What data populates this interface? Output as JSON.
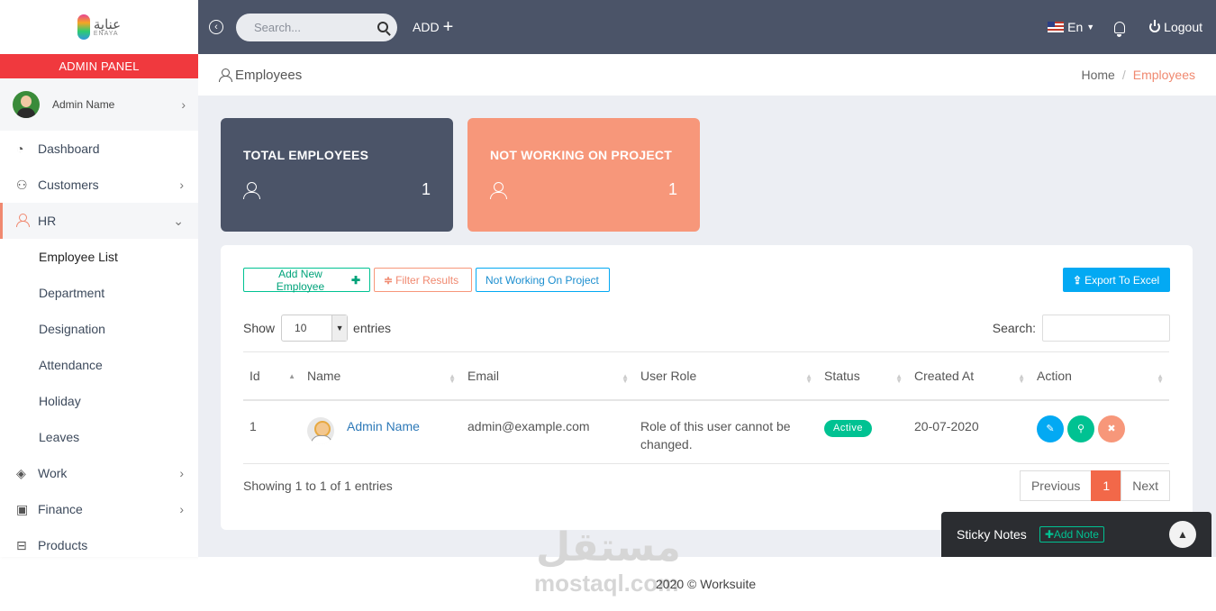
{
  "sidebar": {
    "logo_text": "عناية",
    "logo_sub": "ENAYA",
    "panel_label": "ADMIN PANEL",
    "user_name": "Admin Name",
    "nav": {
      "dashboard": "Dashboard",
      "customers": "Customers",
      "hr": "HR",
      "work": "Work",
      "finance": "Finance",
      "products": "Products"
    },
    "hr_sub": [
      "Employee List",
      "Department",
      "Designation",
      "Attendance",
      "Holiday",
      "Leaves"
    ]
  },
  "topbar": {
    "search_placeholder": "Search...",
    "add_label": "ADD",
    "lang": "En",
    "logout": "Logout"
  },
  "breadcrumb": {
    "title": "Employees",
    "home": "Home",
    "current": "Employees"
  },
  "stats": [
    {
      "title": "TOTAL EMPLOYEES",
      "value": "1"
    },
    {
      "title": "NOT WORKING ON PROJECT",
      "value": "1"
    }
  ],
  "toolbar": {
    "add_employee": "Add New Employee",
    "filter": "Filter Results",
    "not_working": "Not Working On Project",
    "export": "Export To Excel"
  },
  "table_controls": {
    "show": "Show",
    "page_size": "10",
    "entries": "entries",
    "search": "Search:"
  },
  "table": {
    "columns": [
      "Id",
      "Name",
      "Email",
      "User Role",
      "Status",
      "Created At",
      "Action"
    ],
    "rows": [
      {
        "id": "1",
        "name": "Admin Name",
        "email": "admin@example.com",
        "role": "Role of this user cannot be changed.",
        "status": "Active",
        "created": "20-07-2020"
      }
    ]
  },
  "pagination": {
    "info": "Showing 1 to 1 of 1 entries",
    "previous": "Previous",
    "page": "1",
    "next": "Next"
  },
  "footer": {
    "copyright": "2020 © Worksuite",
    "watermark": "مستقل",
    "watermark_sub": "mostaql.com"
  },
  "sticky_notes": {
    "title": "Sticky Notes",
    "add": "Add Note"
  },
  "colors": {
    "topbar": "#4b5468",
    "admin_panel": "#f0393e",
    "accent": "#f7977a",
    "success": "#00c292",
    "info": "#03a9f3"
  }
}
